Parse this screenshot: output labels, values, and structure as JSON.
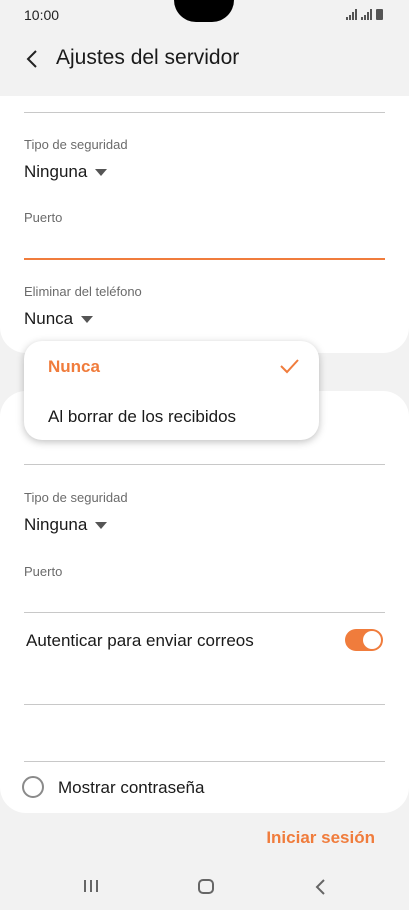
{
  "status_bar": {
    "time": "10:00"
  },
  "app_bar": {
    "title": "Ajustes del servidor"
  },
  "incoming": {
    "security_label": "Tipo de seguridad",
    "security_value": "Ninguna",
    "port_label": "Puerto",
    "port_value": "",
    "delete_label": "Eliminar del teléfono",
    "delete_value": "Nunca"
  },
  "popup": {
    "options": [
      {
        "label": "Nunca",
        "selected": true
      },
      {
        "label": "Al borrar de los recibidos",
        "selected": false
      }
    ]
  },
  "outgoing": {
    "security_label": "Tipo de seguridad",
    "security_value": "Ninguna",
    "port_label": "Puerto",
    "port_value": "",
    "auth_label": "Autenticar para enviar correos",
    "auth_enabled": true,
    "show_password_label": "Mostrar contraseña"
  },
  "login_button": "Iniciar sesión",
  "colors": {
    "accent": "#f07c3c",
    "background": "#f2f2f2",
    "card": "#ffffff"
  }
}
